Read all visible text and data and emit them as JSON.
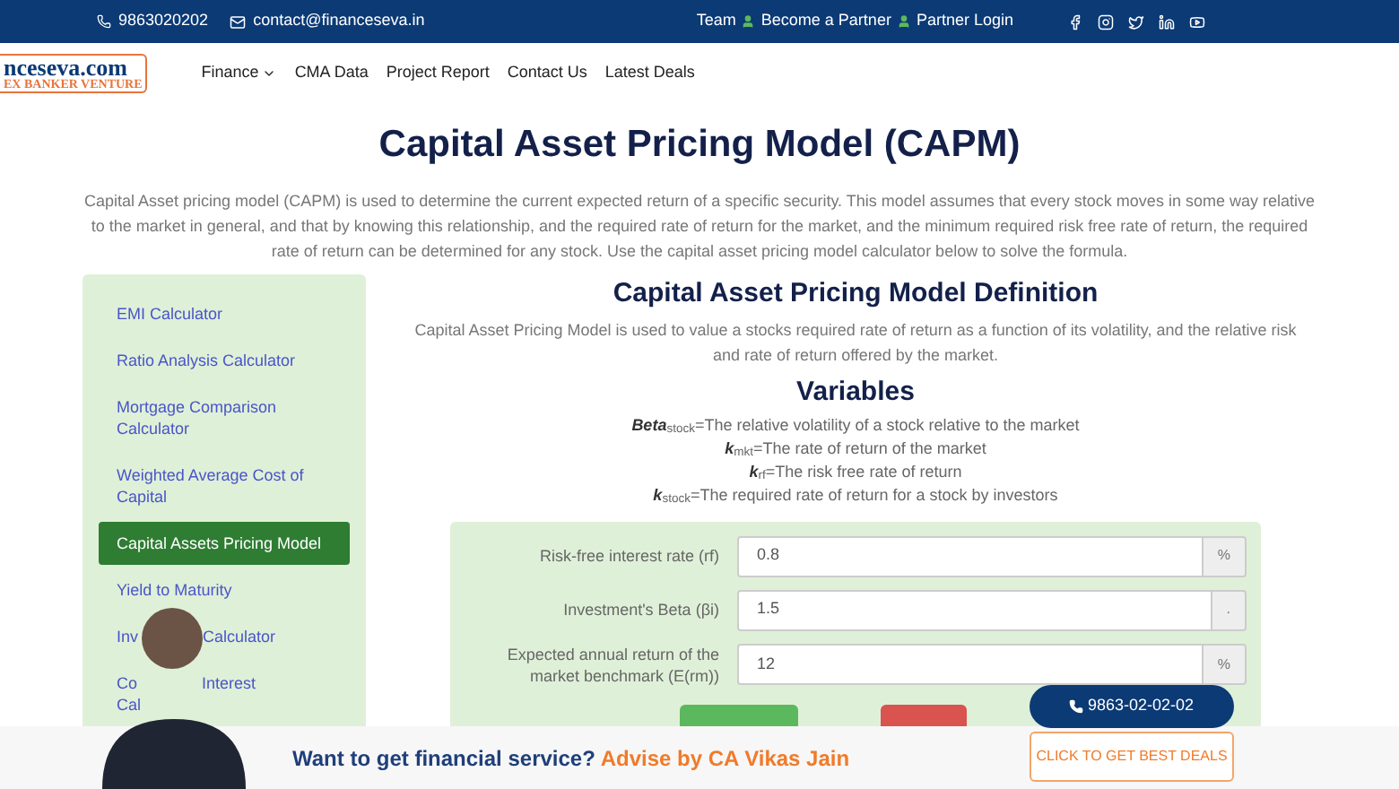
{
  "topbar": {
    "phone": "9863020202",
    "email": "contact@financeseva.in",
    "links": [
      "Team",
      "Become a Partner",
      "Partner Login"
    ]
  },
  "logo": {
    "name": "nceseva.com",
    "tagline": "EX BANKER VENTURE"
  },
  "nav": [
    {
      "label": "Finance",
      "dropdown": true
    },
    {
      "label": "CMA Data",
      "dropdown": false
    },
    {
      "label": "Project Report",
      "dropdown": false
    },
    {
      "label": "Contact Us",
      "dropdown": false
    },
    {
      "label": "Latest Deals",
      "dropdown": false
    }
  ],
  "title": "Capital Asset Pricing Model (CAPM)",
  "intro": "Capital Asset pricing model (CAPM) is used to determine the current expected return of a specific security. This model assumes that every stock moves in some way relative to the market in general, and that by knowing this relationship, and the required rate of return for the market, and the minimum required risk free rate of return, the required rate of return can be determined for any stock. Use the capital asset pricing model calculator below to solve the formula.",
  "sidebar": {
    "items": [
      {
        "label": "EMI Calculator",
        "selected": false
      },
      {
        "label": "Ratio Analysis Calculator",
        "selected": false
      },
      {
        "label": "Mortgage Comparison Calculator",
        "selected": false
      },
      {
        "label": "Weighted Average Cost of Capital",
        "selected": false
      },
      {
        "label": "Capital Assets Pricing Model",
        "selected": true
      },
      {
        "label": "Yield to Maturity",
        "selected": false
      },
      {
        "label": "Inv",
        "label_end": "Calculator",
        "selected": false
      },
      {
        "label": "Co",
        "label_end": "Interest",
        "label_line2": "Cal",
        "selected": false
      }
    ]
  },
  "definition": {
    "heading": "Capital Asset Pricing Model Definition",
    "text": "Capital Asset Pricing Model is used to value a stocks required rate of return as a function of its volatility, and the relative risk and rate of return offered by the market."
  },
  "variables": {
    "heading": "Variables",
    "lines": [
      "*Beta*$_{stock}$=The relative volatility of a stock relative to the market",
      "*k*$_{mkt}$=The rate of return of the market",
      "*k*$_{rf}$=The risk free rate of return",
      "*k*$_{stock}$=The required rate of return for a stock by investors"
    ]
  },
  "form": {
    "fields": [
      {
        "label": "Risk-free interest rate (rf)",
        "value": "0.8",
        "unit": "%"
      },
      {
        "label": "Investment's Beta (βi)",
        "value": "1.5",
        "unit": "."
      },
      {
        "label": "Expected annual return of the market benchmark (E(rm))",
        "value": "12",
        "unit": "%"
      }
    ]
  },
  "banner": {
    "question": "Want to get financial service?",
    "highlight": "Advise by CA Vikas Jain"
  },
  "call_button": "9863-02-02-02",
  "deals_button": "CLICK TO GET BEST DEALS"
}
